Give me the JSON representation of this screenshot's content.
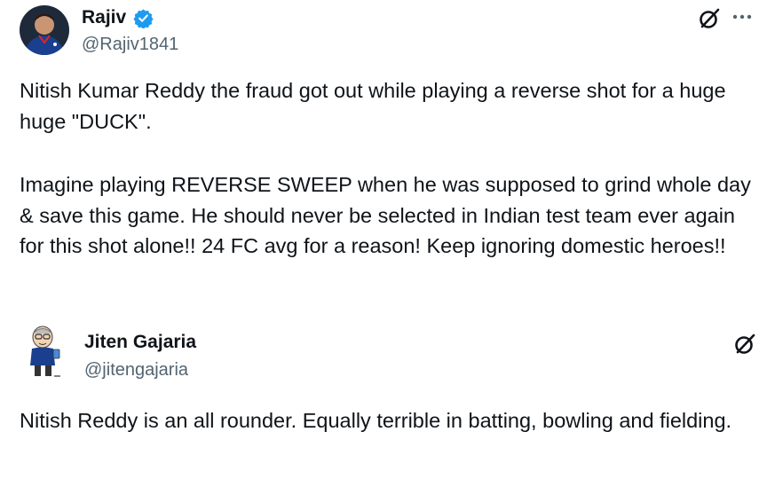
{
  "posts": [
    {
      "display_name": "Rajiv",
      "handle": "@Rajiv1841",
      "verified": true,
      "avatar_icon": "user-avatar-photo",
      "paragraphs": [
        "Nitish Kumar Reddy the fraud got out while playing a reverse shot for a huge huge \"DUCK\".",
        "Imagine playing REVERSE SWEEP when he was supposed to grind whole day & save this game. He should never be selected in Indian test team ever again for this shot alone!! 24 FC avg for a reason! Keep ignoring domestic heroes!!"
      ]
    },
    {
      "display_name": "Jiten Gajaria",
      "handle": "@jitengajaria",
      "verified": false,
      "avatar_icon": "cartoon-avatar",
      "paragraphs": [
        "Nitish Reddy is an all rounder. Equally terrible in batting, bowling and fielding."
      ]
    }
  ],
  "colors": {
    "text": "#0f1419",
    "handle": "#536471",
    "verified": "#1d9bf0",
    "jersey": "#1b3f8f"
  }
}
